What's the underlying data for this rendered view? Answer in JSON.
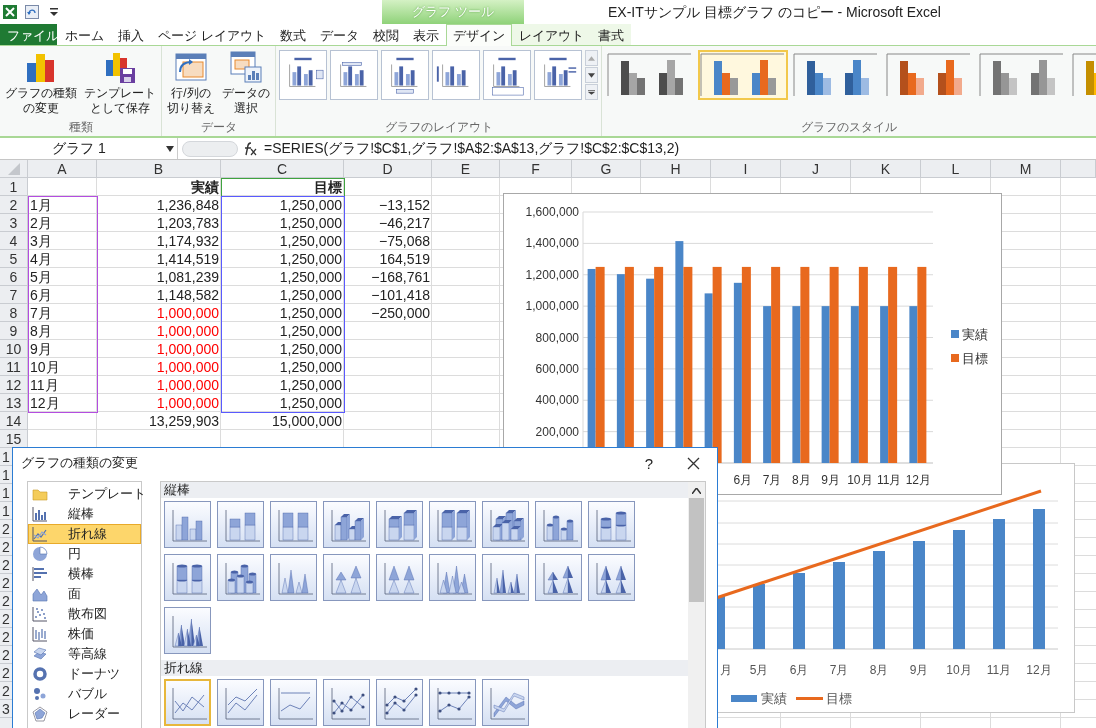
{
  "title_bar": {
    "title": "EX-ITサンプル  目標グラフ のコピー - Microsoft Excel",
    "context_header": "グラフ ツール"
  },
  "ribbon_tabs": [
    {
      "label": "ファイル",
      "kind": "file",
      "selected": false
    },
    {
      "label": "ホーム",
      "kind": "plain",
      "selected": false
    },
    {
      "label": "挿入",
      "kind": "plain",
      "selected": false
    },
    {
      "label": "ページ レイアウト",
      "kind": "plain",
      "selected": false
    },
    {
      "label": "数式",
      "kind": "plain",
      "selected": false
    },
    {
      "label": "データ",
      "kind": "plain",
      "selected": false
    },
    {
      "label": "校閲",
      "kind": "plain",
      "selected": false
    },
    {
      "label": "表示",
      "kind": "plain",
      "selected": false
    },
    {
      "label": "デザイン",
      "kind": "context",
      "selected": true
    },
    {
      "label": "レイアウト",
      "kind": "context",
      "selected": false
    },
    {
      "label": "書式",
      "kind": "context",
      "selected": false
    }
  ],
  "ribbon_groups": [
    {
      "label": "種類",
      "kind": "buttons",
      "buttons": [
        {
          "kind": "chart",
          "label": "グラフの種類の変更"
        },
        {
          "kind": "template",
          "label": "テンプレートとして保存"
        }
      ]
    },
    {
      "label": "データ",
      "kind": "buttons",
      "buttons": [
        {
          "kind": "switch",
          "label": "行/列の切り替え"
        },
        {
          "kind": "select",
          "label": "データの選択"
        }
      ]
    },
    {
      "label": "グラフのレイアウト",
      "kind": "layouts",
      "items": [
        {
          "kind": "legend-right"
        },
        {
          "kind": "labels-top"
        },
        {
          "kind": "legend-bottom"
        },
        {
          "kind": "plain"
        },
        {
          "kind": "table"
        },
        {
          "kind": "legend-inline"
        }
      ]
    },
    {
      "label": "グラフのスタイル",
      "kind": "styles",
      "items": [
        {
          "selected": false
        },
        {
          "selected": true
        },
        {
          "selected": false
        },
        {
          "selected": false
        },
        {
          "selected": false
        },
        {
          "selected": false
        }
      ]
    }
  ],
  "formula_bar": {
    "name_box": "グラフ 1",
    "formula": "=SERIES(グラフ!$C$1,グラフ!$A$2:$A$13,グラフ!$C$2:$C$13,2)"
  },
  "sheet": {
    "columns": [
      "A",
      "B",
      "C",
      "D",
      "E",
      "F",
      "G",
      "H",
      "I",
      "J",
      "K",
      "L",
      "M"
    ],
    "rows": [
      {
        "number": "1",
        "b": "実績",
        "b_alert": false,
        "c": "目標"
      },
      {
        "number": "2",
        "a": "1月",
        "b": "1,236,848",
        "b_alert": false,
        "c": "1,250,000",
        "d": "−13,152"
      },
      {
        "number": "3",
        "a": "2月",
        "b": "1,203,783",
        "b_alert": false,
        "c": "1,250,000",
        "d": "−46,217"
      },
      {
        "number": "4",
        "a": "3月",
        "b": "1,174,932",
        "b_alert": false,
        "c": "1,250,000",
        "d": "−75,068"
      },
      {
        "number": "5",
        "a": "4月",
        "b": "1,414,519",
        "b_alert": false,
        "c": "1,250,000",
        "d": "164,519"
      },
      {
        "number": "6",
        "a": "5月",
        "b": "1,081,239",
        "b_alert": false,
        "c": "1,250,000",
        "d": "−168,761"
      },
      {
        "number": "7",
        "a": "6月",
        "b": "1,148,582",
        "b_alert": false,
        "c": "1,250,000",
        "d": "−101,418"
      },
      {
        "number": "8",
        "a": "7月",
        "b": "1,000,000",
        "b_alert": true,
        "c": "1,250,000",
        "d": "−250,000"
      },
      {
        "number": "9",
        "a": "8月",
        "b": "1,000,000",
        "b_alert": true,
        "c": "1,250,000"
      },
      {
        "number": "10",
        "a": "9月",
        "b": "1,000,000",
        "b_alert": true,
        "c": "1,250,000"
      },
      {
        "number": "11",
        "a": "10月",
        "b": "1,000,000",
        "b_alert": true,
        "c": "1,250,000"
      },
      {
        "number": "12",
        "a": "11月",
        "b": "1,000,000",
        "b_alert": true,
        "c": "1,250,000"
      },
      {
        "number": "13",
        "a": "12月",
        "b": "1,000,000",
        "b_alert": true,
        "c": "1,250,000"
      },
      {
        "number": "14",
        "b": "13,259,903",
        "b_alert": false,
        "c": "15,000,000"
      },
      {
        "number": "15"
      }
    ],
    "covered_row_numbers": [
      "1",
      "1",
      "1",
      "1",
      "2",
      "2",
      "2",
      "2",
      "2",
      "2",
      "2",
      "2",
      "2",
      "2",
      "3"
    ]
  },
  "chart_1": {
    "chart_data": {
      "type": "bar",
      "x": [
        1,
        2,
        3,
        4,
        5,
        6,
        7,
        8,
        9,
        10,
        11,
        12
      ],
      "xticks": [
        {
          "value": 6,
          "label": "6月"
        },
        {
          "value": 7,
          "label": "7月"
        },
        {
          "value": 8,
          "label": "8月"
        },
        {
          "value": 9,
          "label": "9月"
        },
        {
          "value": 10,
          "label": "10月"
        },
        {
          "value": 11,
          "label": "11月"
        },
        {
          "value": 12,
          "label": "12月"
        }
      ],
      "xlim": [
        0.5,
        12.5
      ],
      "grid": true,
      "legend": "right",
      "series": [
        {
          "name": "実績",
          "color": "#4a86c8",
          "values": [
            1236848,
            1203783,
            1174932,
            1414519,
            1081239,
            1148582,
            1000000,
            1000000,
            1000000,
            1000000,
            1000000,
            1000000
          ]
        },
        {
          "name": "目標",
          "color": "#e8691e",
          "values": [
            1250000,
            1250000,
            1250000,
            1250000,
            1250000,
            1250000,
            1250000,
            1250000,
            1250000,
            1250000,
            1250000,
            1250000
          ]
        }
      ],
      "ylim": [
        0,
        1600000
      ],
      "yticks": [
        {
          "value": 200000,
          "label": "200,000"
        },
        {
          "value": 400000,
          "label": "400,000"
        },
        {
          "value": 600000,
          "label": "600,000"
        },
        {
          "value": 800000,
          "label": "800,000"
        },
        {
          "value": 1000000,
          "label": "1,000,000"
        },
        {
          "value": 1200000,
          "label": "1,200,000"
        },
        {
          "value": 1400000,
          "label": "1,400,000"
        },
        {
          "value": 1600000,
          "label": "1,600,000"
        }
      ]
    }
  },
  "chart_2": {
    "x_labels": [
      "月",
      "5月",
      "6月",
      "7月",
      "8月",
      "9月",
      "10月",
      "11月",
      "12月"
    ],
    "legend": [
      {
        "label": "実績",
        "kind": "bar",
        "color": "#4a86c8"
      },
      {
        "label": "目標",
        "kind": "line",
        "color": "#e8691e"
      }
    ]
  },
  "dialog": {
    "title": "グラフの種類の変更",
    "help_label": "?",
    "categories": [
      {
        "label": "テンプレート",
        "kind": "folder",
        "selected": false
      },
      {
        "label": "縦棒",
        "kind": "column",
        "selected": false
      },
      {
        "label": "折れ線",
        "kind": "line",
        "selected": true
      },
      {
        "label": "円",
        "kind": "pie",
        "selected": false
      },
      {
        "label": "横棒",
        "kind": "bar",
        "selected": false
      },
      {
        "label": "面",
        "kind": "area",
        "selected": false
      },
      {
        "label": "散布図",
        "kind": "scatter",
        "selected": false
      },
      {
        "label": "株価",
        "kind": "stock",
        "selected": false
      },
      {
        "label": "等高線",
        "kind": "surface",
        "selected": false
      },
      {
        "label": "ドーナツ",
        "kind": "donut",
        "selected": false
      },
      {
        "label": "バブル",
        "kind": "bubble",
        "selected": false
      },
      {
        "label": "レーダー",
        "kind": "radar",
        "selected": false
      }
    ],
    "sections": [
      {
        "label": "縦棒",
        "items": [
          {
            "kind": "col-clustered",
            "selected": false
          },
          {
            "kind": "col-stacked",
            "selected": false
          },
          {
            "kind": "col-full",
            "selected": false
          },
          {
            "kind": "col3d-clustered",
            "selected": false
          },
          {
            "kind": "col3d-stacked",
            "selected": false
          },
          {
            "kind": "col3d-full",
            "selected": false
          },
          {
            "kind": "col3d-deep",
            "selected": false
          },
          {
            "kind": "cyl-clustered",
            "selected": false
          },
          {
            "kind": "cyl-stacked",
            "selected": false
          },
          {
            "kind": "cyl-full",
            "selected": false
          },
          {
            "kind": "cyl-deep",
            "selected": false
          },
          {
            "kind": "cone-clustered",
            "selected": false
          },
          {
            "kind": "cone-stacked",
            "selected": false
          },
          {
            "kind": "cone-full",
            "selected": false
          },
          {
            "kind": "cone-deep",
            "selected": false
          },
          {
            "kind": "pyr-clustered",
            "selected": false
          },
          {
            "kind": "pyr-stacked",
            "selected": false
          },
          {
            "kind": "pyr-full",
            "selected": false
          },
          {
            "kind": "pyr-deep",
            "selected": false
          }
        ]
      },
      {
        "label": "折れ線",
        "items": [
          {
            "kind": "line-plain",
            "selected": true
          },
          {
            "kind": "line-stacked",
            "selected": false
          },
          {
            "kind": "line-full",
            "selected": false
          },
          {
            "kind": "line-marker",
            "selected": false
          },
          {
            "kind": "line-markerstacked",
            "selected": false
          },
          {
            "kind": "line-markerfull",
            "selected": false
          },
          {
            "kind": "line-deep",
            "selected": false
          }
        ]
      }
    ]
  }
}
